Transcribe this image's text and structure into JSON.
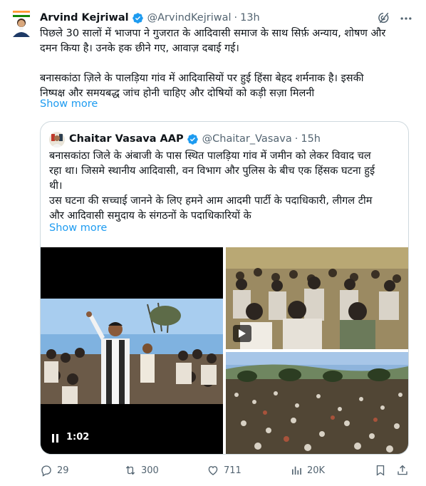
{
  "tweet": {
    "author_name": "Arvind Kejriwal",
    "handle": "@ArvindKejriwal",
    "time": "13h",
    "body_lines": [
      "पिछले 30 सालों में भाजपा ने गुजरात के आदिवासी समाज के साथ सिर्फ़ अन्याय, शोषण और",
      "दमन किया है। उनके हक छीने गए, आवाज़ दबाई गई।",
      "बनासकांठा ज़िले के पालड़िया गांव में आदिवासियों पर हुई हिंसा बेहद शर्मनाक है। इसकी",
      "निष्पक्ष और समयबद्ध जांच होनी चाहिए और दोषियों को कड़ी सज़ा मिलनी"
    ],
    "show_more": "Show more"
  },
  "quote": {
    "author_name": "Chaitar Vasava AAP",
    "handle": "@Chaitar_Vasava",
    "time": "15h",
    "body_lines": [
      "बनासकांठा जिले के अंबाजी के पास स्थित पालड़िया गांव में जमीन को लेकर विवाद चल",
      "रहा था। जिसमे स्थानीय आदिवासी, वन विभाग और पुलिस के बीच एक हिंसक घटना हुई",
      "थी।",
      "उस घटना की सच्चाई जानने के लिए हमने आम आदमी पार्टी के पदाधिकारी, लीगल टीम",
      "और आदिवासी समुदाय के संगठनों के पदाधिकारियों के"
    ],
    "show_more": "Show more",
    "video_time": "1:02"
  },
  "actions": {
    "replies": "29",
    "reposts": "300",
    "likes": "711",
    "views": "20K"
  },
  "icons": {
    "verified": "verified-badge-icon",
    "grok": "grok-icon",
    "more": "more-icon",
    "reply": "reply-icon",
    "repost": "repost-icon",
    "like": "heart-icon",
    "views": "views-icon",
    "bookmark": "bookmark-icon",
    "share": "share-icon"
  },
  "colors": {
    "accent": "#1d9bf0",
    "muted": "#536471",
    "border": "#cfd9de"
  }
}
